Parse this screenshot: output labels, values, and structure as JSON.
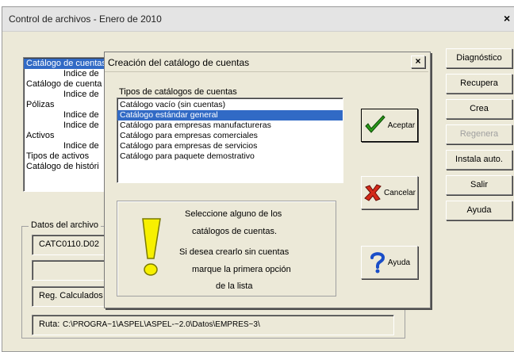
{
  "main_window": {
    "title": "Control de archivos - Enero de 2010",
    "close_label": "×"
  },
  "buttons": {
    "diagnostico": "Diagnóstico",
    "recupera": "Recupera",
    "crea": "Crea",
    "regenera": "Regenera",
    "instala_auto": "Instala auto.",
    "salir": "Salir",
    "ayuda": "Ayuda"
  },
  "file_list": {
    "items": [
      "Catálogo de cuentas",
      "Indice de",
      "Catálogo de cuenta",
      "Indice de",
      "Pólizas",
      "Indice de",
      "Indice de",
      "Activos",
      "Indice de",
      "Tipos de activos",
      "Catálogo de históri"
    ]
  },
  "datos_archivo": {
    "legend": "Datos del archivo",
    "filename": "CATC0110.D02",
    "reg_calculados": "Reg. Calculados",
    "ruta_label": "Ruta:",
    "ruta_value": "C:\\PROGRA~1\\ASPEL\\ASPEL-~2.0\\Datos\\EMPRES~3\\"
  },
  "dialog": {
    "title": "Creación del catálogo de cuentas",
    "close_label": "×",
    "list_label": "Tipos de catálogos de cuentas",
    "options": [
      "Catálogo vacío (sin cuentas)",
      "Catálogo estándar general",
      "Catálogo para empresas manufactureras",
      "Catálogo para empresas comerciales",
      "Catálogo para empresas de servicios",
      "Catálogo para paquete demostrativo"
    ],
    "selected_index": 1,
    "info": {
      "line1": "Seleccione alguno de los",
      "line2": "catálogos de cuentas.",
      "line3": "Si desea crearlo sin cuentas",
      "line4": "marque la primera opción",
      "line5": "de  la  lista"
    },
    "aceptar": "Aceptar",
    "cancelar": "Cancelar",
    "ayuda": "Ayuda",
    "colors": {
      "selection": "#316ac5",
      "title_bar": "#ece9d8"
    }
  }
}
